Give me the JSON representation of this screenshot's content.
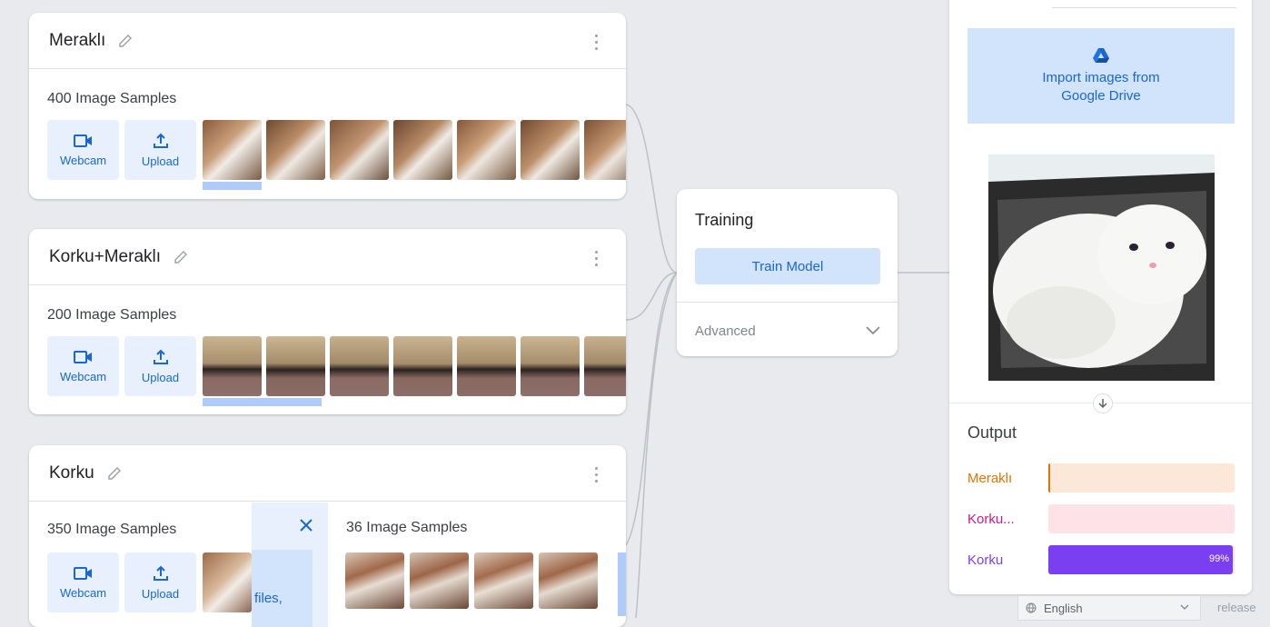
{
  "classes": [
    {
      "name": "Meraklı",
      "samples_label": "400 Image Samples",
      "webcam_label": "Webcam",
      "upload_label": "Upload"
    },
    {
      "name": "Korku+Meraklı",
      "samples_label": "200 Image Samples",
      "webcam_label": "Webcam",
      "upload_label": "Upload"
    },
    {
      "name": "Korku",
      "samples_label": "350 Image Samples",
      "webcam_label": "Webcam",
      "upload_label": "Upload",
      "upload_pane_text": "files,",
      "upload_samples_label": "36 Image Samples"
    }
  ],
  "training": {
    "title": "Training",
    "train_button": "Train Model",
    "advanced_label": "Advanced"
  },
  "preview": {
    "drive_button": "Import images from Google Drive",
    "output_title": "Output",
    "outputs": [
      {
        "label": "Meraklı",
        "value": 0.01,
        "color": "#e37400",
        "bg": "#fce8d9",
        "pct_text": ""
      },
      {
        "label": "Korku...",
        "value": 0.0,
        "color": "#d01884",
        "bg": "#fde2e7",
        "pct_text": ""
      },
      {
        "label": "Korku",
        "value": 0.99,
        "color": "#7b3ff2",
        "bg": "#7b3ff2",
        "pct_text": "99%"
      }
    ]
  },
  "footer": {
    "language": "English",
    "release_text": "release"
  },
  "icons": {
    "edit": "pencil-icon",
    "menu": "kebab-icon",
    "webcam": "video-camera-icon",
    "upload": "upload-icon",
    "drive": "google-drive-icon",
    "expand": "chevron-down-icon",
    "close": "close-icon",
    "arrow": "arrow-down-icon",
    "globe": "globe-icon"
  }
}
